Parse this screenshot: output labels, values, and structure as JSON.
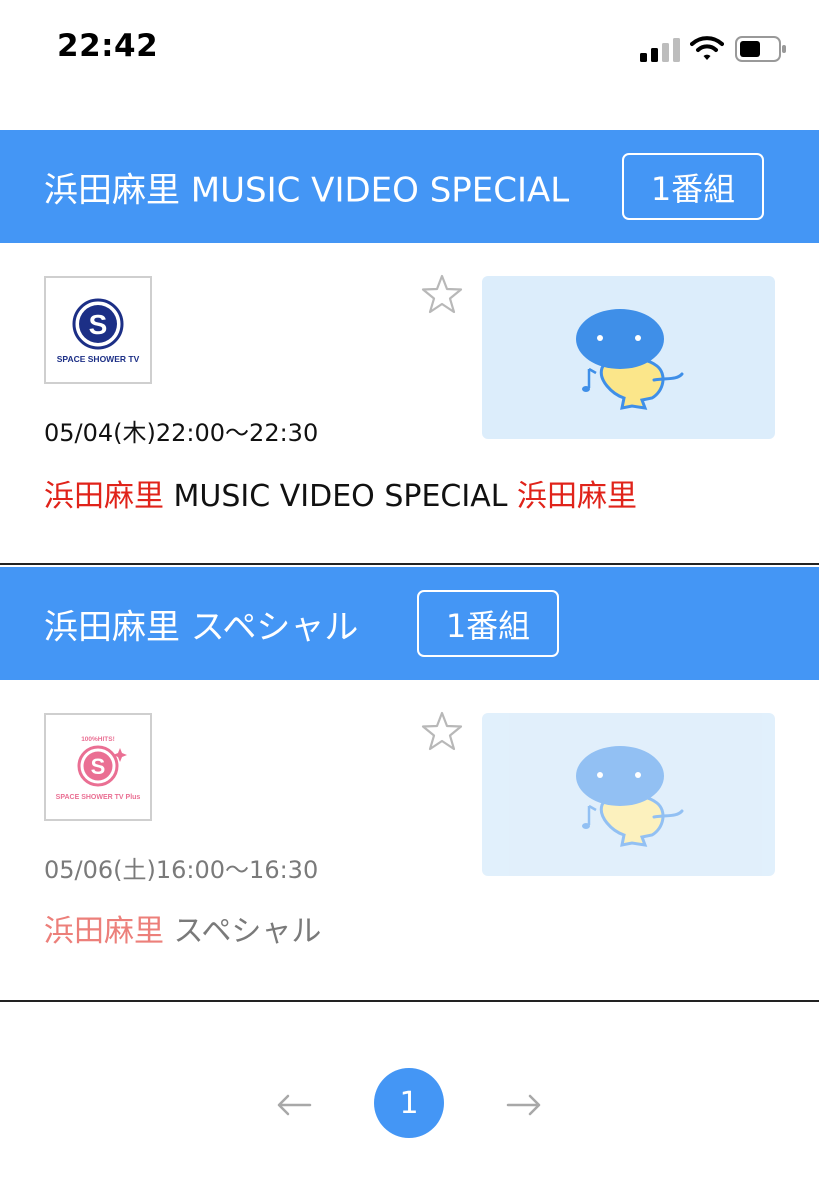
{
  "status_bar": {
    "time": "22:42"
  },
  "sections": [
    {
      "title": "浜田麻里 MUSIC VIDEO SPECIAL",
      "badge": "1番組",
      "program": {
        "channel_logo_text": "SPACE SHOWER TV",
        "air_time": "05/04(木)22:00〜22:30",
        "title_hl_1": "浜田麻里",
        "title_plain": " MUSIC VIDEO SPECIAL ",
        "title_hl_2": "浜田麻里"
      }
    },
    {
      "title": "浜田麻里 スペシャル",
      "badge": "1番組",
      "program": {
        "channel_logo_top_text": "100%HITS!",
        "channel_logo_text": "SPACE SHOWER TV Plus",
        "air_time": "05/06(土)16:00〜16:30",
        "title_hl_1": "浜田麻里",
        "title_plain": " スペシャル"
      }
    }
  ],
  "pagination": {
    "current_page": "1"
  },
  "colors": {
    "accent": "#4496f5",
    "highlight": "#e0231a",
    "thumbnail_bg": "#dcedfb",
    "mascot_blue": "#3f8fe8",
    "mascot_yellow": "#fbe68a"
  }
}
